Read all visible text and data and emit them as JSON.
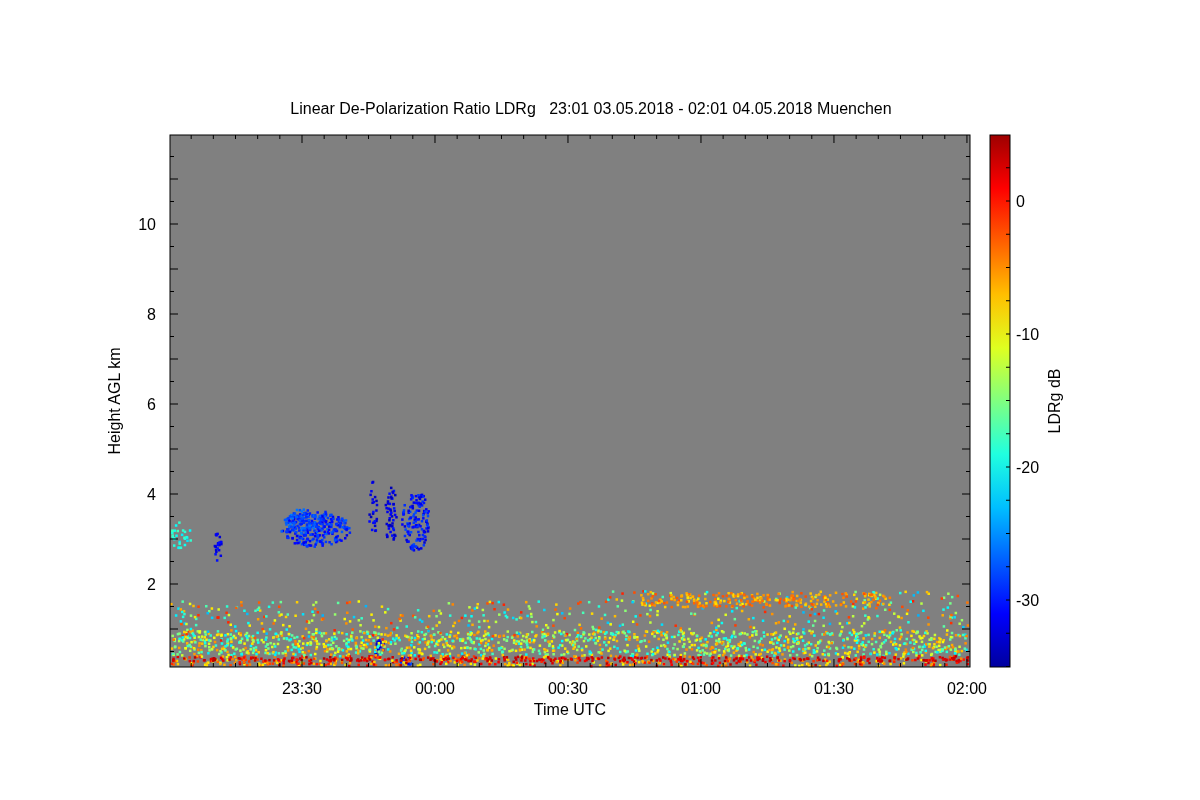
{
  "chart": {
    "title": "Linear De-Polarization Ratio LDRg   23:01 03.05.2018 - 02:01 04.05.2018 Muenchen",
    "ylabel": "Height AGL km",
    "xlabel": "Time UTC",
    "y_tick_labels": [
      "10",
      "8",
      "6",
      "4",
      "2"
    ],
    "x_tick_labels": [
      "23:30",
      "00:00",
      "00:30",
      "01:00",
      "01:30",
      "02:00"
    ]
  },
  "colorbar": {
    "label": "LDRg dB",
    "tick_labels": [
      "0",
      "-10",
      "-20",
      "-30"
    ]
  }
}
